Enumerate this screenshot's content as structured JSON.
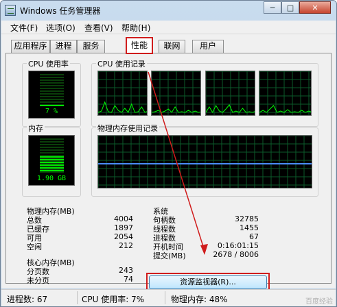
{
  "window": {
    "title": "Windows 任务管理器"
  },
  "controls": {
    "minimize": "─",
    "maximize": "□",
    "close": "✕"
  },
  "menu": [
    "文件(F)",
    "选项(O)",
    "查看(V)",
    "帮助(H)"
  ],
  "tabs": [
    {
      "label": "应用程序",
      "active": false
    },
    {
      "label": "进程",
      "active": false
    },
    {
      "label": "服务",
      "active": false
    },
    {
      "label": "性能",
      "active": true
    },
    {
      "label": "联网",
      "active": false
    },
    {
      "label": "用户",
      "active": false
    }
  ],
  "cpu": {
    "label": "CPU 使用率",
    "value_text": "7 %",
    "percent": 7
  },
  "cpu_history": {
    "label": "CPU 使用记录"
  },
  "memory": {
    "label": "内存",
    "value_text": "1.90 GB",
    "fraction": 0.48
  },
  "memory_history": {
    "label": "物理内存使用记录"
  },
  "physical_memory": {
    "title": "物理内存(MB)",
    "rows": [
      {
        "key": "总数",
        "value": "4004"
      },
      {
        "key": "已缓存",
        "value": "1897"
      },
      {
        "key": "可用",
        "value": "2054"
      },
      {
        "key": "空闲",
        "value": "212"
      }
    ]
  },
  "kernel_memory": {
    "title": "核心内存(MB)",
    "rows": [
      {
        "key": "分页数",
        "value": "243"
      },
      {
        "key": "未分页",
        "value": "74"
      }
    ]
  },
  "system": {
    "title": "系统",
    "rows": [
      {
        "key": "句柄数",
        "value": "32785"
      },
      {
        "key": "线程数",
        "value": "1455"
      },
      {
        "key": "进程数",
        "value": "67"
      },
      {
        "key": "开机时间",
        "value": "0:16:01:15"
      },
      {
        "key": "提交(MB)",
        "value": "2678 / 8006"
      }
    ]
  },
  "resource_monitor_button": "资源监视器(R)...",
  "status": {
    "processes": "进程数: 67",
    "cpu": "CPU 使用率: 7%",
    "memory": "物理内存: 48%"
  },
  "watermark": "百度经验",
  "colors": {
    "graph_green": "#00ff00",
    "memory_line": "#4a8cff",
    "highlight_red": "#d01c1c"
  },
  "icons": {
    "app": "task-manager-icon"
  }
}
